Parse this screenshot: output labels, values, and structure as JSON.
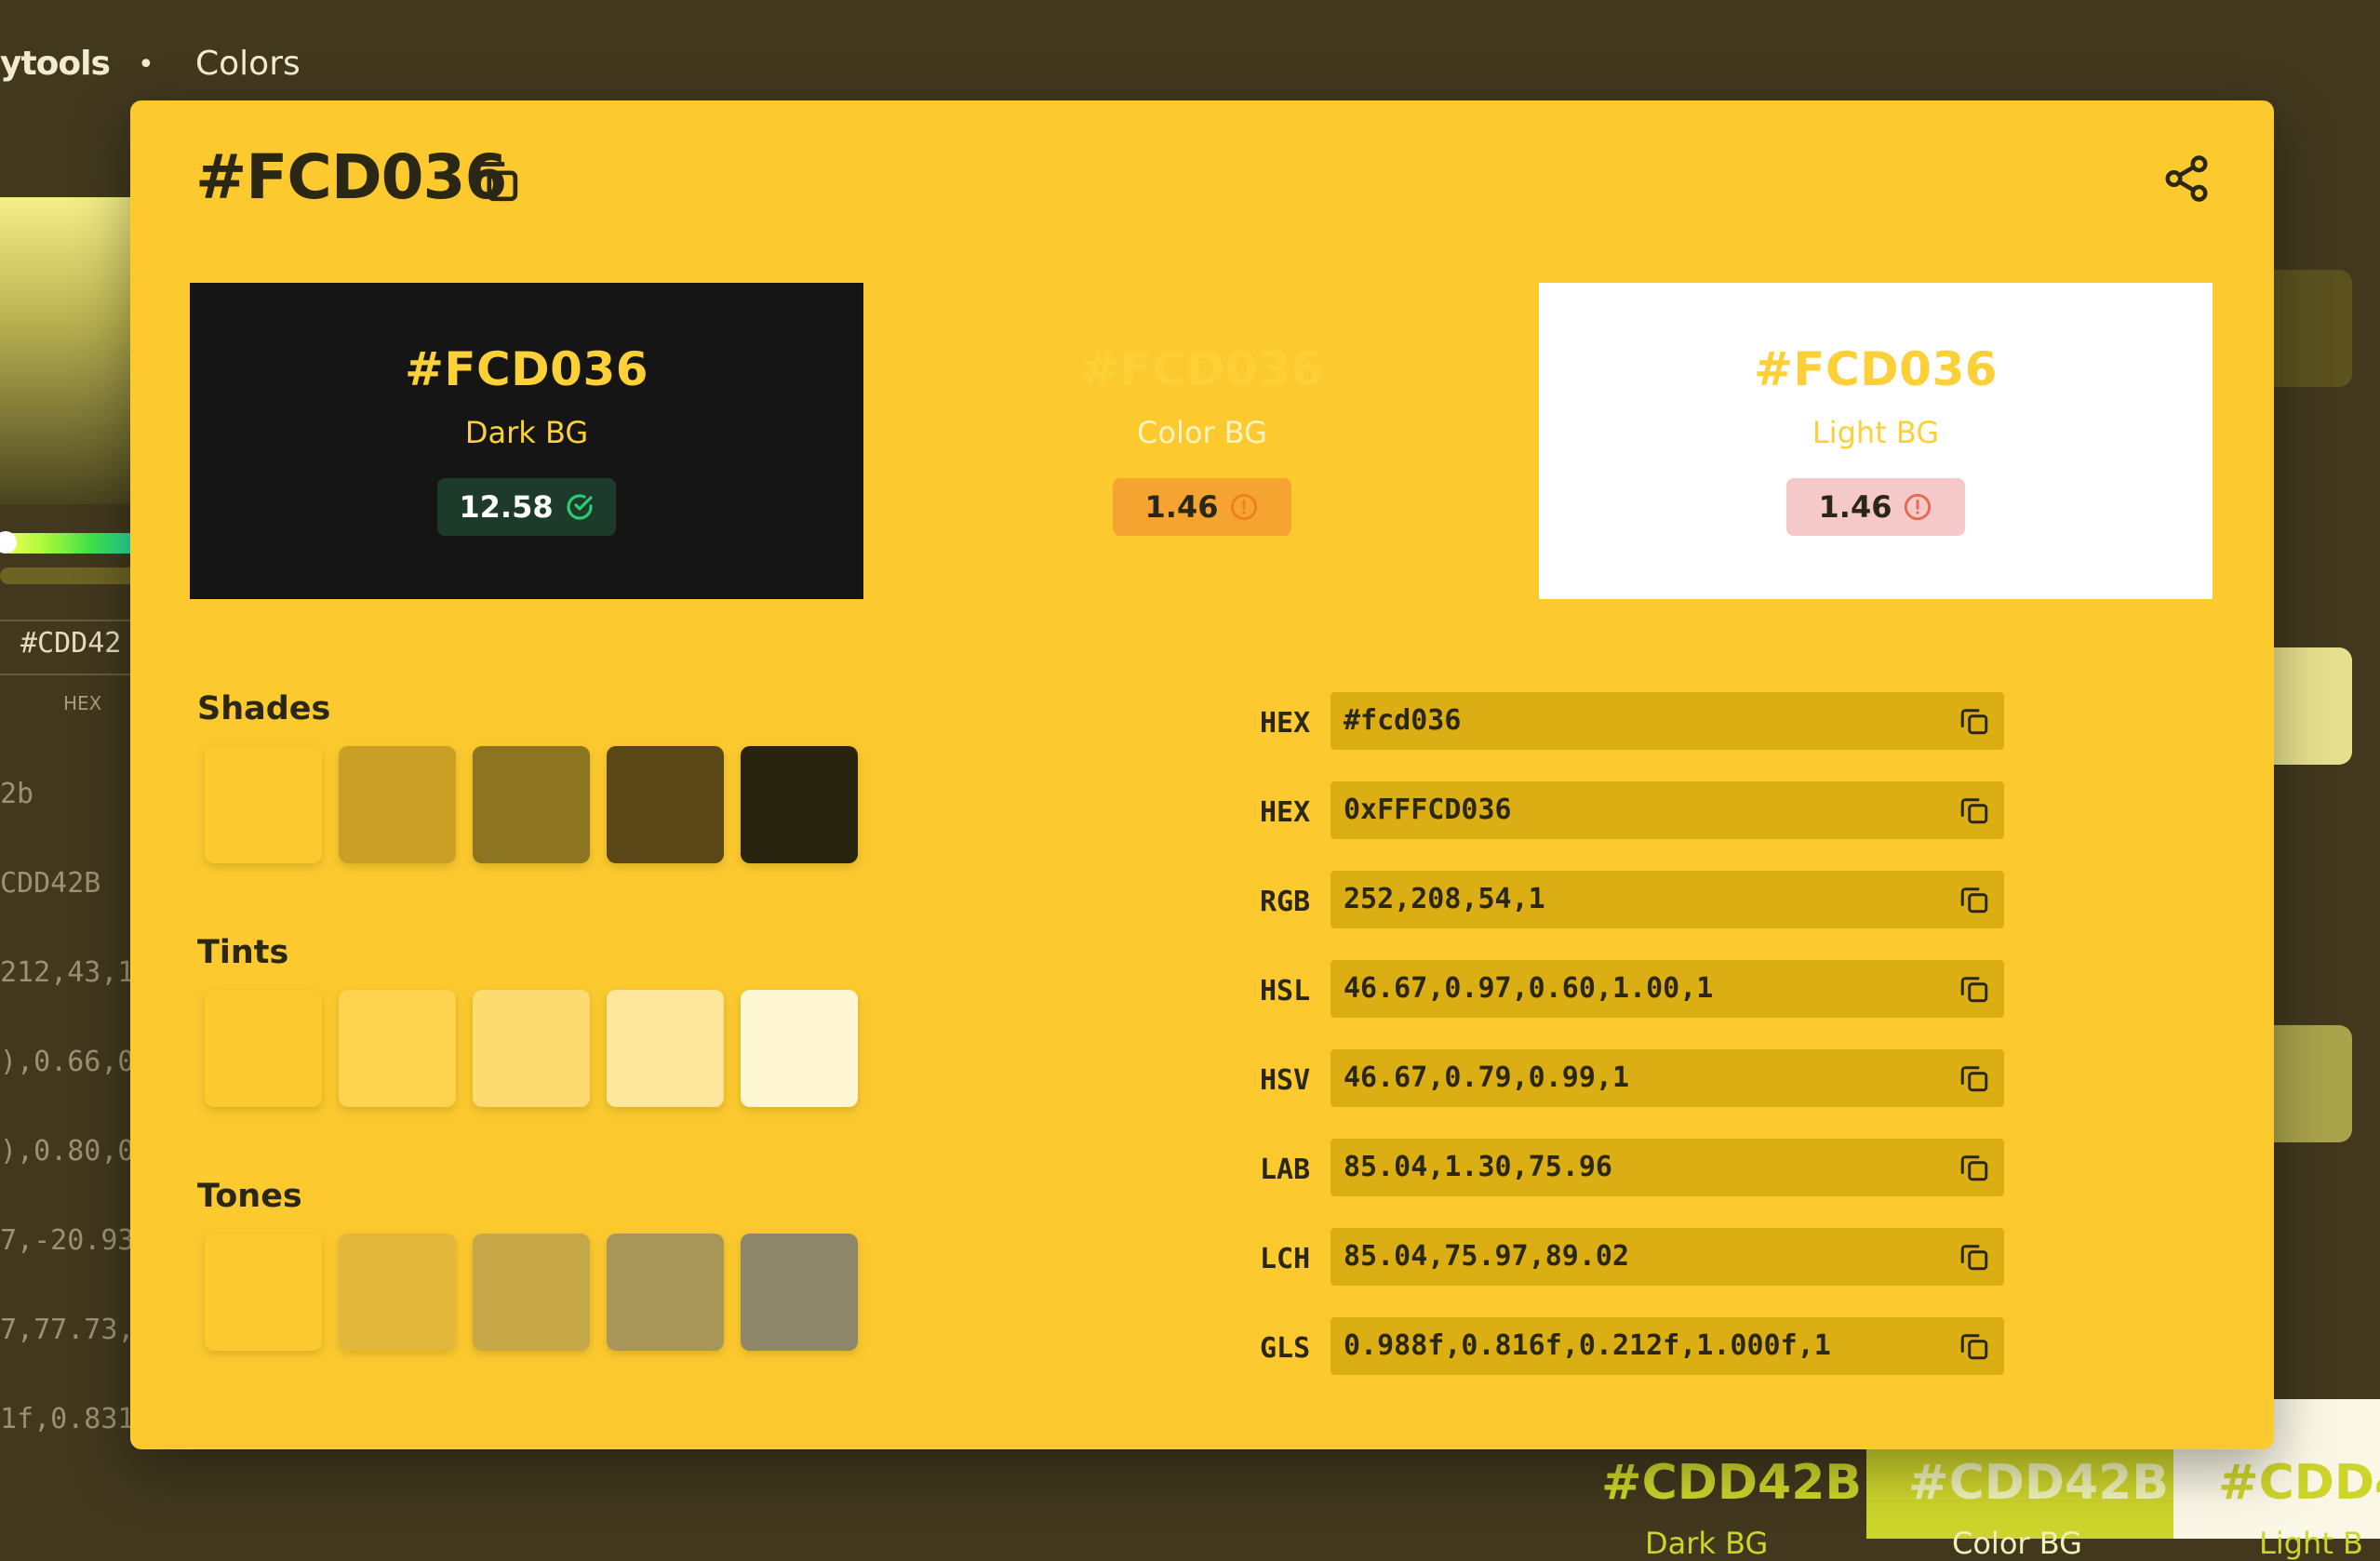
{
  "background": {
    "brand": "ytools",
    "separator": "•",
    "breadcrumb": "Colors",
    "hex_input_value": "#CDD42",
    "hex_input_label": "HEX",
    "partial_rows": [
      "2b",
      "CDD42B",
      "212,43,1",
      "),0.66,0",
      "),0.80,0",
      "7,-20.93",
      "7,77.73,",
      "1f,0.831"
    ],
    "bottom_previews": [
      {
        "hex": "#CDD42B",
        "label": "Dark BG"
      },
      {
        "hex": "#CDD42B",
        "label": "Color BG"
      },
      {
        "hex": "#CDD4",
        "label": "Light B"
      }
    ]
  },
  "modal": {
    "title": "#FCD036",
    "copy_icon": "copy-icon",
    "share_icon": "share-icon",
    "previews": [
      {
        "hex": "#FCD036",
        "label": "Dark BG",
        "contrast": "12.58",
        "status": "pass",
        "bg": "#151515",
        "label_color": "#fcd036",
        "badge_bg": "#1e3a2a",
        "badge_fg": "#ffffff",
        "icon_color": "#2ecc71"
      },
      {
        "hex": "#FCD036",
        "label": "Color BG",
        "contrast": "1.46",
        "status": "fail",
        "bg": "#fcca2f",
        "label_color": "#fff3c5",
        "badge_bg": "#f5a431",
        "badge_fg": "#2b2715",
        "icon_color": "#e8821f"
      },
      {
        "hex": "#FCD036",
        "label": "Light BG",
        "contrast": "1.46",
        "status": "fail",
        "bg": "#ffffff",
        "label_color": "#fcd036",
        "badge_bg": "#f5c9c9",
        "badge_fg": "#2b2715",
        "icon_color": "#e36b4f"
      }
    ],
    "shades_title": "Shades",
    "shades": [
      "#fcca2f",
      "#c99f25",
      "#8c7420",
      "#5a4717",
      "#29240f"
    ],
    "tints_title": "Tints",
    "tints": [
      "#fcca2f",
      "#fdd24f",
      "#fedb70",
      "#fee79c",
      "#fff6d4"
    ],
    "tones_title": "Tones",
    "tones": [
      "#fcca2f",
      "#e2b83c",
      "#c7a849",
      "#a89659",
      "#8e8668"
    ],
    "formats": [
      {
        "label": "HEX",
        "value": "#fcd036"
      },
      {
        "label": "HEX",
        "value": "0xFFFCD036"
      },
      {
        "label": "RGB",
        "value": "252,208,54,1"
      },
      {
        "label": "HSL",
        "value": "46.67,0.97,0.60,1.00,1"
      },
      {
        "label": "HSV",
        "value": "46.67,0.79,0.99,1"
      },
      {
        "label": "LAB",
        "value": "85.04,1.30,75.96"
      },
      {
        "label": "LCH",
        "value": "85.04,75.97,89.02"
      },
      {
        "label": "GLS",
        "value": "0.988f,0.816f,0.212f,1.000f,1"
      }
    ]
  }
}
